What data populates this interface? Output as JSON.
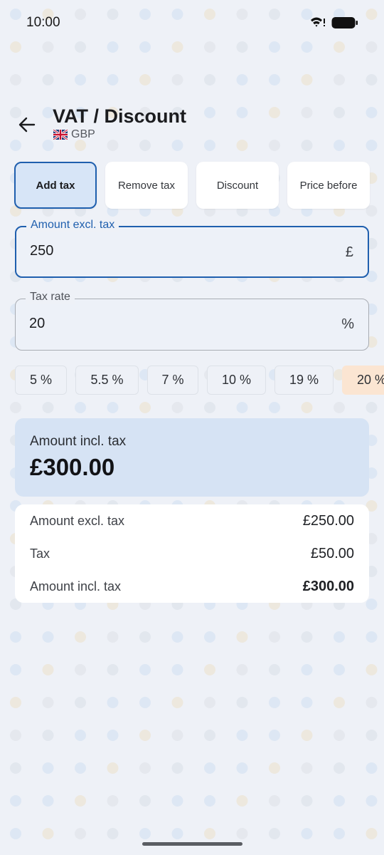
{
  "status_bar": {
    "time": "10:00",
    "wifi_icon": "wifi-icon",
    "battery_icon": "battery-icon"
  },
  "header": {
    "title": "VAT / Discount",
    "currency": "GBP",
    "flag_icon": "uk-flag-icon",
    "back_icon": "arrow-left-icon"
  },
  "modes": [
    {
      "label": "Add tax",
      "active": true
    },
    {
      "label": "Remove tax",
      "active": false
    },
    {
      "label": "Discount",
      "active": false
    },
    {
      "label": "Price before",
      "active": false
    }
  ],
  "amount_field": {
    "label": "Amount excl. tax",
    "value": "250",
    "suffix": "£"
  },
  "rate_field": {
    "label": "Tax rate",
    "value": "20",
    "suffix": "%"
  },
  "rate_chips": [
    {
      "label": "5 %",
      "selected": false
    },
    {
      "label": "5.5 %",
      "selected": false
    },
    {
      "label": "7 %",
      "selected": false
    },
    {
      "label": "10 %",
      "selected": false
    },
    {
      "label": "19 %",
      "selected": false
    },
    {
      "label": "20 %",
      "selected": true
    }
  ],
  "result": {
    "label": "Amount incl. tax",
    "value": "£300.00"
  },
  "breakdown": [
    {
      "label": "Amount excl. tax",
      "value": "£250.00"
    },
    {
      "label": "Tax",
      "value": "£50.00"
    },
    {
      "label": "Amount incl. tax",
      "value": "£300.00"
    }
  ],
  "colors": {
    "accent": "#1f5fae",
    "background": "#eef1f7",
    "result_card": "#d6e3f4",
    "selected_chip": "#fbe5d2"
  }
}
